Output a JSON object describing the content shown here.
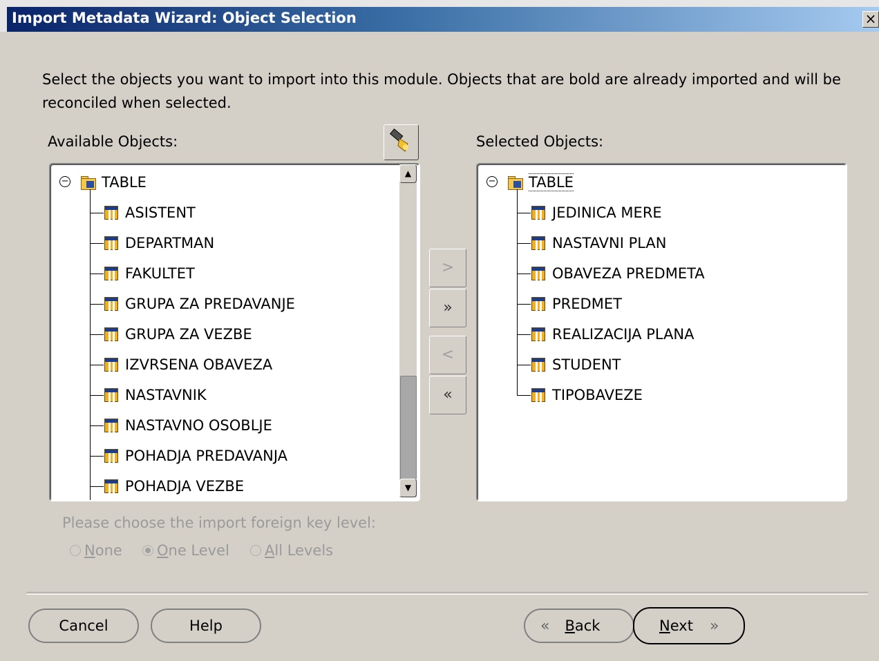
{
  "window": {
    "title": "Import Metadata Wizard: Object Selection",
    "close_glyph": "×"
  },
  "instructions": "Select the objects you want to import into this module. Objects that are bold are already imported and will be reconciled when selected.",
  "available": {
    "label": "Available Objects:",
    "root": "TABLE",
    "items": [
      "ASISTENT",
      "DEPARTMAN",
      "FAKULTET",
      "GRUPA ZA PREDAVANJE",
      "GRUPA ZA VEZBE",
      "IZVRSENA OBAVEZA",
      "NASTAVNIK",
      "NASTAVNO OSOBLJE",
      "POHADJA PREDAVANJA",
      "POHADJA VEZBE"
    ],
    "scroll_fraction": 0.45
  },
  "selected": {
    "label": "Selected Objects:",
    "root": "TABLE",
    "items": [
      "JEDINICA MERE",
      "NASTAVNI PLAN",
      "OBAVEZA PREDMETA",
      "PREDMET",
      "REALIZACIJA PLANA",
      "STUDENT",
      "TIPOBAVEZE"
    ]
  },
  "move_buttons": {
    "add": ">",
    "add_all": "»",
    "remove": "<",
    "remove_all": "«"
  },
  "foreign_key": {
    "label": "Please choose the import foreign key level:",
    "options": [
      {
        "key": "N",
        "rest": "one",
        "selected": false
      },
      {
        "key": "O",
        "rest": "ne Level",
        "selected": true
      },
      {
        "key": "A",
        "rest": "ll Levels",
        "selected": false
      }
    ]
  },
  "buttons": {
    "cancel": "Cancel",
    "help": "Help",
    "back_key": "B",
    "back_rest": "ack",
    "next_key": "N",
    "next_rest": "ext"
  },
  "icons": [
    "flashlight-icon",
    "folder-icon",
    "table-icon",
    "chevron-left-icon",
    "chevron-right-icon"
  ]
}
